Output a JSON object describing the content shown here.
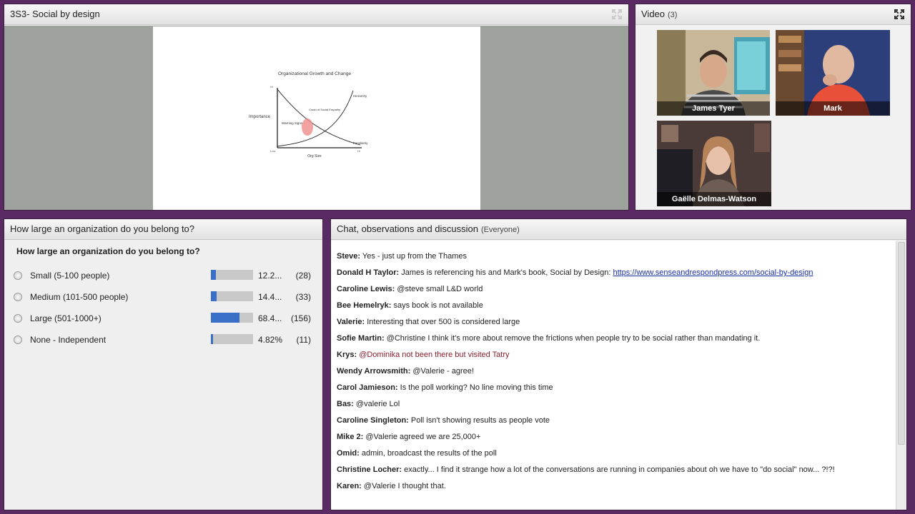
{
  "share": {
    "title": "3S3- Social by design"
  },
  "slide": {
    "title": "Organizational Growth and Change",
    "ylabel": "Importance",
    "xlabel": "Org Size",
    "hi": "Hi",
    "lo": "Low",
    "hi_x": "Hi",
    "curve_hierarchy": "Hierarchy",
    "curve_familiarity": "Familiarity",
    "warning": "Warning Signs",
    "crash": "Crash of Social Empathy"
  },
  "video": {
    "title": "Video",
    "count": "(3)",
    "participants": [
      {
        "name": "James Tyer"
      },
      {
        "name": "Mark"
      },
      {
        "name": "Gaëlle Delmas-Watson"
      }
    ]
  },
  "poll": {
    "title": "How large an organization do you belong to?",
    "question": "How large an organization do you belong to?",
    "options": [
      {
        "label": "Small (5-100 people)",
        "pct": "12.2...",
        "votes": "(28)",
        "share": 12.2
      },
      {
        "label": "Medium (101-500 people)",
        "pct": "14.4...",
        "votes": "(33)",
        "share": 14.4
      },
      {
        "label": "Large (501-1000+)",
        "pct": "68.4...",
        "votes": "(156)",
        "share": 68.4
      },
      {
        "label": "None - Independent",
        "pct": "4.82%",
        "votes": "(11)",
        "share": 4.82
      }
    ]
  },
  "chat": {
    "title": "Chat, observations and discussion",
    "audience": "(Everyone)",
    "messages": [
      {
        "who": "Steve:",
        "text": "Yes - just up from the Thames"
      },
      {
        "who": "Donald H Taylor:",
        "text": "James is referencing his and Mark's book, Social by Design:",
        "link": "https://www.senseandrespondpress.com/social-by-design"
      },
      {
        "who": "Caroline Lewis:",
        "text": "@steve small L&D world"
      },
      {
        "who": "Bee Hemelryk:",
        "text": "says book is not available"
      },
      {
        "who": "Valerie:",
        "text": "Interesting that over 500 is considered large"
      },
      {
        "who": "Sofie Martin:",
        "text": "@Christine I think it's more about remove the frictions when people try to be social rather than mandating it."
      },
      {
        "who": "Krys:",
        "text": "@Dominika not been there but visited Tatry",
        "red": true
      },
      {
        "who": "Wendy Arrowsmith:",
        "text": "@Valerie - agree!"
      },
      {
        "who": "Carol Jamieson:",
        "text": "Is the poll working?  No line moving this time"
      },
      {
        "who": "Bas:",
        "text": "@valerie Lol"
      },
      {
        "who": "Caroline Singleton:",
        "text": "Poll isn't showing results as people vote"
      },
      {
        "who": "Mike 2:",
        "text": "@Valerie agreed we are 25,000+"
      },
      {
        "who": "Omid:",
        "text": "admin, broadcast the results of the poll"
      },
      {
        "who": "Christine Locher:",
        "text": "exactly... I find it strange how a lot of the conversations are running in companies about oh we have to \"do social\" now... ?!?!"
      },
      {
        "who": "Karen:",
        "text": "@Valerie I thought that."
      }
    ]
  }
}
